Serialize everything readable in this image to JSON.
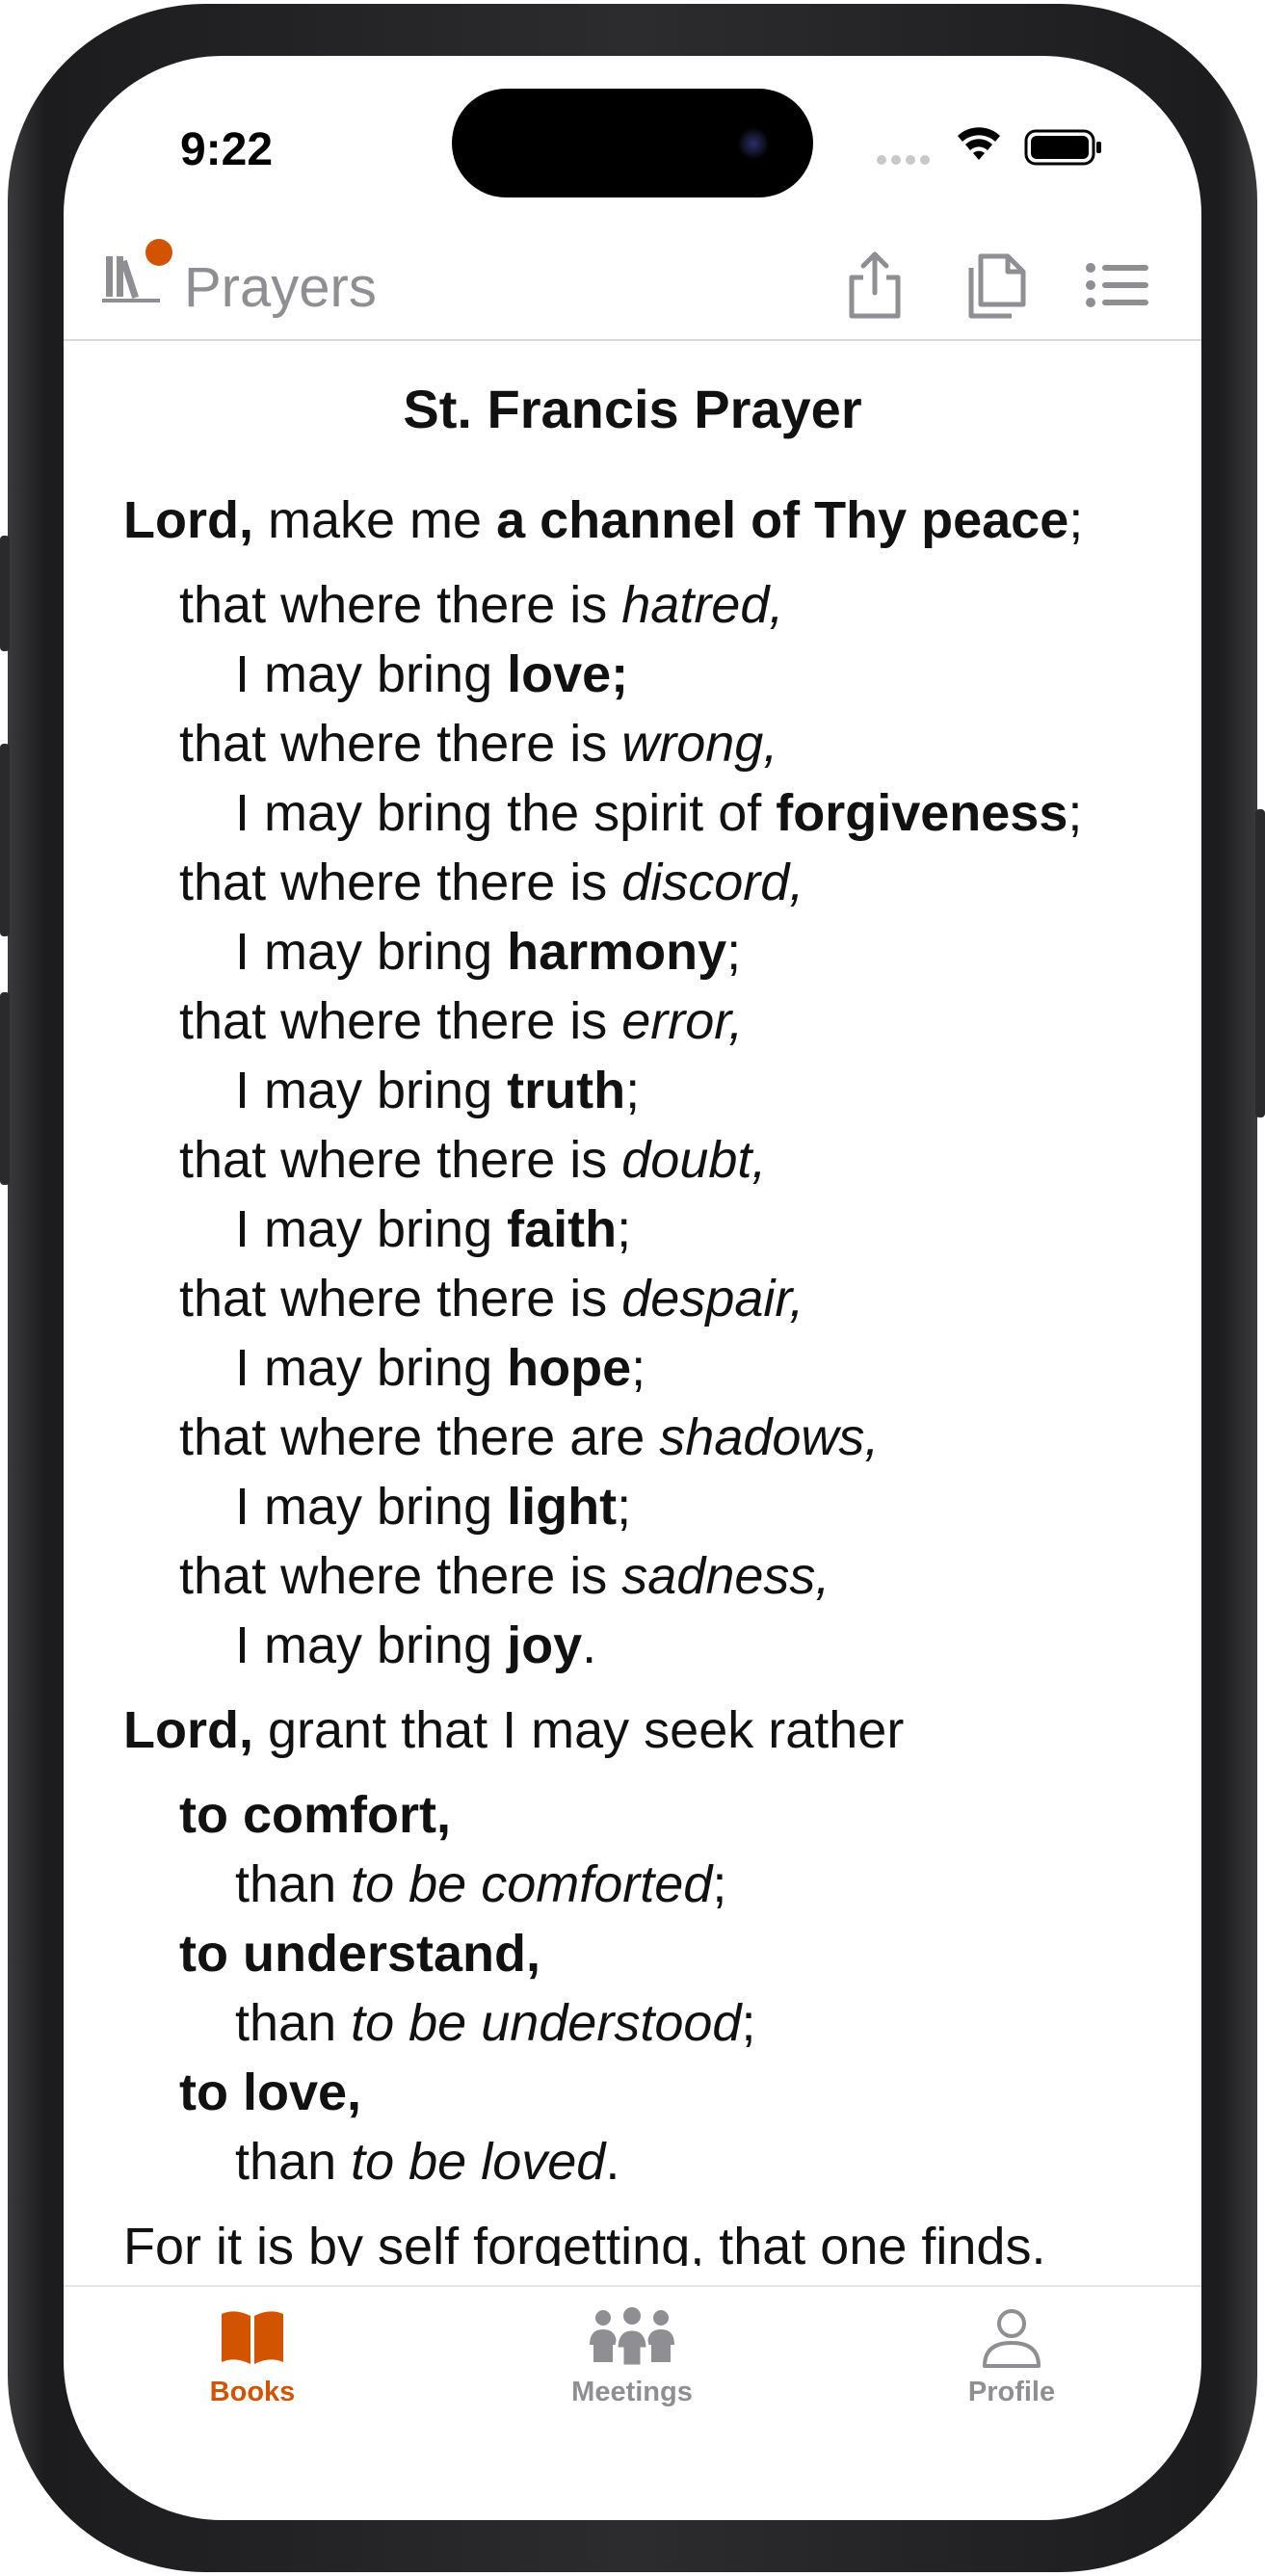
{
  "status_bar": {
    "time": "9:22"
  },
  "header": {
    "title": "Prayers",
    "accent_color": "#d35400"
  },
  "prayer": {
    "title": "St. Francis Prayer",
    "lines": [
      {
        "indent": 0,
        "segs": [
          [
            "b",
            "Lord,"
          ],
          [
            "n",
            " make me "
          ],
          [
            "b",
            "a channel of Thy peace"
          ],
          [
            "n",
            ";"
          ]
        ]
      },
      {
        "indent": 1,
        "segs": [
          [
            "n",
            "that where there is "
          ],
          [
            "i",
            "hatred,"
          ]
        ]
      },
      {
        "indent": 2,
        "segs": [
          [
            "n",
            "I may bring "
          ],
          [
            "b",
            "love;"
          ]
        ]
      },
      {
        "indent": 1,
        "segs": [
          [
            "n",
            "that where there is "
          ],
          [
            "i",
            "wrong,"
          ]
        ]
      },
      {
        "indent": 2,
        "segs": [
          [
            "n",
            "I may bring the spirit of "
          ],
          [
            "b",
            "forgiveness"
          ],
          [
            "n",
            ";"
          ]
        ]
      },
      {
        "indent": 1,
        "segs": [
          [
            "n",
            "that where there is "
          ],
          [
            "i",
            "discord,"
          ]
        ]
      },
      {
        "indent": 2,
        "segs": [
          [
            "n",
            "I may bring "
          ],
          [
            "b",
            "harmony"
          ],
          [
            "n",
            ";"
          ]
        ]
      },
      {
        "indent": 1,
        "segs": [
          [
            "n",
            "that where there is "
          ],
          [
            "i",
            "error,"
          ]
        ]
      },
      {
        "indent": 2,
        "segs": [
          [
            "n",
            "I may bring "
          ],
          [
            "b",
            "truth"
          ],
          [
            "n",
            ";"
          ]
        ]
      },
      {
        "indent": 1,
        "segs": [
          [
            "n",
            "that where there is "
          ],
          [
            "i",
            "doubt,"
          ]
        ]
      },
      {
        "indent": 2,
        "segs": [
          [
            "n",
            "I may bring "
          ],
          [
            "b",
            "faith"
          ],
          [
            "n",
            ";"
          ]
        ]
      },
      {
        "indent": 1,
        "segs": [
          [
            "n",
            "that where there is "
          ],
          [
            "i",
            "despair,"
          ]
        ]
      },
      {
        "indent": 2,
        "segs": [
          [
            "n",
            "I may bring "
          ],
          [
            "b",
            "hope"
          ],
          [
            "n",
            ";"
          ]
        ]
      },
      {
        "indent": 1,
        "segs": [
          [
            "n",
            "that where there are "
          ],
          [
            "i",
            "shadows,"
          ]
        ]
      },
      {
        "indent": 2,
        "segs": [
          [
            "n",
            "I may bring "
          ],
          [
            "b",
            "light"
          ],
          [
            "n",
            ";"
          ]
        ]
      },
      {
        "indent": 1,
        "segs": [
          [
            "n",
            "that where there is "
          ],
          [
            "i",
            "sadness,"
          ]
        ]
      },
      {
        "indent": 2,
        "segs": [
          [
            "n",
            "I may bring "
          ],
          [
            "b",
            "joy"
          ],
          [
            "n",
            "."
          ]
        ]
      },
      {
        "indent": 0,
        "segs": [
          [
            "b",
            "Lord,"
          ],
          [
            "n",
            " grant that I may seek rather"
          ]
        ]
      },
      {
        "indent": 1,
        "segs": [
          [
            "b",
            "to comfort,"
          ]
        ]
      },
      {
        "indent": 2,
        "segs": [
          [
            "n",
            "than "
          ],
          [
            "i",
            "to be comforted"
          ],
          [
            "n",
            ";"
          ]
        ]
      },
      {
        "indent": 1,
        "segs": [
          [
            "b",
            "to understand,"
          ]
        ]
      },
      {
        "indent": 2,
        "segs": [
          [
            "n",
            "than "
          ],
          [
            "i",
            "to be understood"
          ],
          [
            "n",
            ";"
          ]
        ]
      },
      {
        "indent": 1,
        "segs": [
          [
            "b",
            "to love,"
          ]
        ]
      },
      {
        "indent": 2,
        "segs": [
          [
            "n",
            "than "
          ],
          [
            "i",
            "to be loved"
          ],
          [
            "n",
            "."
          ]
        ]
      },
      {
        "indent": 0,
        "segs": [
          [
            "n",
            "For it is by self forgetting, that one finds."
          ]
        ]
      }
    ]
  },
  "tabs": [
    {
      "label": "Books",
      "icon": "book-icon",
      "active": true
    },
    {
      "label": "Meetings",
      "icon": "people-icon",
      "active": false
    },
    {
      "label": "Profile",
      "icon": "person-icon",
      "active": false
    }
  ]
}
